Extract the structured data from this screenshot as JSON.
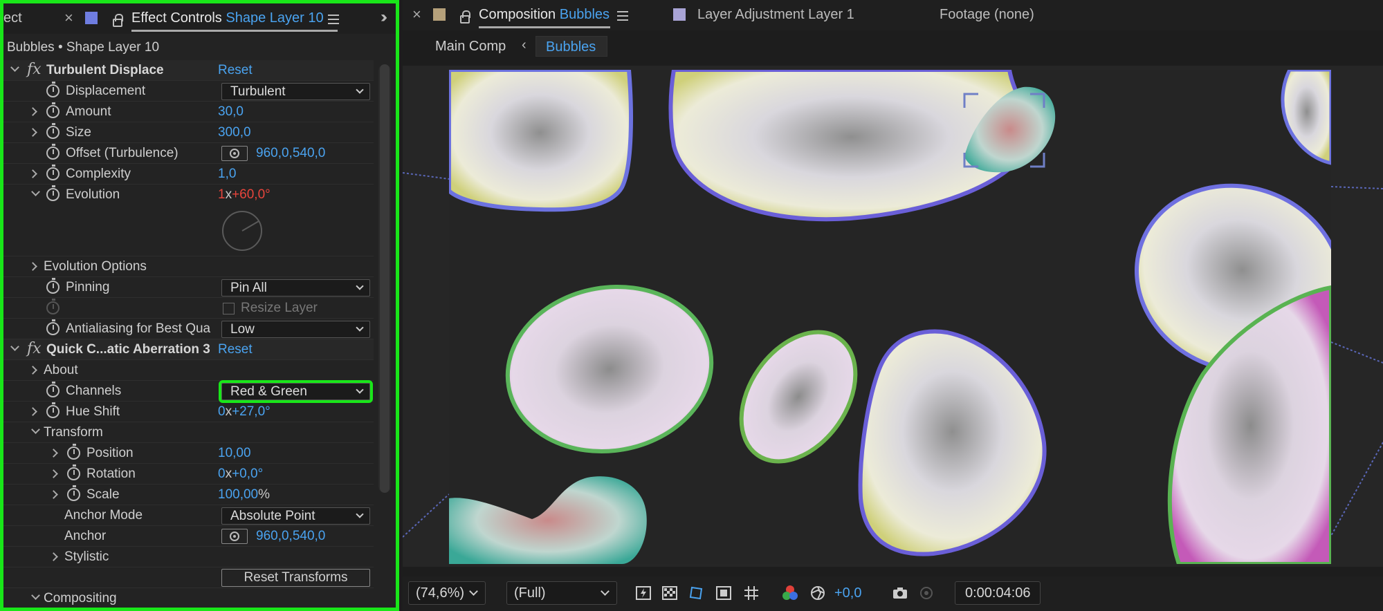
{
  "left_panel": {
    "partial_tab": "ect",
    "tab_title": "Effect Controls",
    "tab_layer": "Shape Layer 10",
    "breadcrumb": "Bubbles • Shape Layer 10",
    "effect1": {
      "name": "Turbulent Displace",
      "reset": "Reset",
      "displacement": {
        "label": "Displacement",
        "value": "Turbulent"
      },
      "amount": {
        "label": "Amount",
        "value": "30,0"
      },
      "size": {
        "label": "Size",
        "value": "300,0"
      },
      "offset": {
        "label": "Offset (Turbulence)",
        "value": "960,0,540,0"
      },
      "complexity": {
        "label": "Complexity",
        "value": "1,0"
      },
      "evolution": {
        "label": "Evolution",
        "rev": "1",
        "x": "x",
        "deg": "+60,0°"
      },
      "evolution_options": "Evolution Options",
      "pinning": {
        "label": "Pinning",
        "value": "Pin All"
      },
      "resize_layer": "Resize Layer",
      "antialiasing": {
        "label": "Antialiasing for Best Qua",
        "value": "Low"
      }
    },
    "effect2": {
      "name": "Quick C...atic Aberration 3",
      "reset": "Reset",
      "about": "About",
      "channels": {
        "label": "Channels",
        "value": "Red & Green"
      },
      "hue_shift": {
        "label": "Hue Shift",
        "rev": "0",
        "x": "x",
        "deg": "+27,0°"
      },
      "transform": "Transform",
      "position": {
        "label": "Position",
        "value": "10,00"
      },
      "rotation": {
        "label": "Rotation",
        "rev": "0",
        "x": "x",
        "deg": "+0,0°"
      },
      "scale": {
        "label": "Scale",
        "value": "100,00",
        "unit": "%"
      },
      "anchor_mode": {
        "label": "Anchor Mode",
        "value": "Absolute Point"
      },
      "anchor": {
        "label": "Anchor",
        "value": "960,0,540,0"
      },
      "stylistic": "Stylistic",
      "reset_transforms": "Reset Transforms",
      "compositing": "Compositing"
    }
  },
  "right_panel": {
    "tab_composition": "Composition",
    "tab_composition_name": "Bubbles",
    "tab_layer": "Layer Adjustment Layer 1",
    "tab_footage": "Footage (none)",
    "crumb_main": "Main Comp",
    "crumb_current": "Bubbles",
    "zoom": "(74,6%)",
    "resolution": "(Full)",
    "exposure": "+0,0",
    "timecode": "0:00:04:06"
  },
  "colors": {
    "highlight_green": "#19e619",
    "value_blue": "#4aa3f0",
    "keyframe_red": "#e8453c",
    "comp_tab_swatch": "#b5a07a",
    "layer_tab_swatch": "#a9a4d6",
    "effect_tab_swatch": "#6f7de0"
  }
}
